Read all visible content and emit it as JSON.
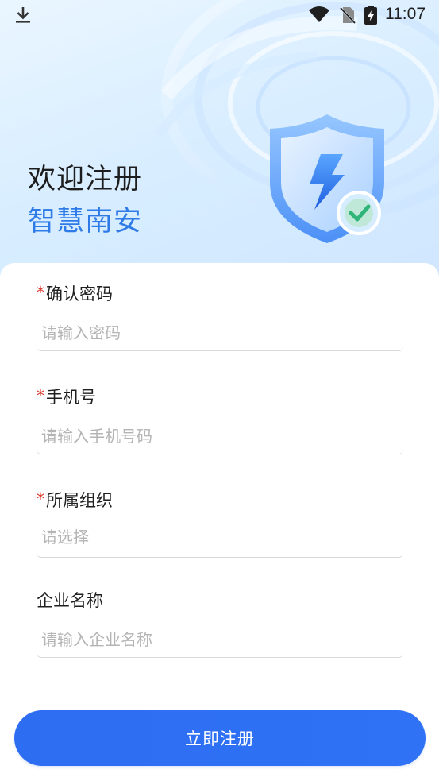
{
  "status_bar": {
    "time": "11:07",
    "icons": [
      "download-icon",
      "wifi-icon",
      "no-sim-icon",
      "battery-charging-icon"
    ]
  },
  "header": {
    "title": "欢迎注册",
    "subtitle": "智慧南安",
    "illustration": "shield-lightning-check-icon"
  },
  "form": {
    "confirm_password": {
      "required_mark": "*",
      "label": "确认密码",
      "placeholder": "请输入密码",
      "value": ""
    },
    "phone": {
      "required_mark": "*",
      "label": "手机号",
      "placeholder": "请输入手机号码",
      "value": ""
    },
    "organization": {
      "required_mark": "*",
      "label": "所属组织",
      "placeholder": "请选择"
    },
    "company_name": {
      "label": "企业名称",
      "placeholder": "请输入企业名称",
      "value": ""
    }
  },
  "submit_label": "立即注册",
  "colors": {
    "accent": "#2e6ff3",
    "subtitle": "#2e7be8",
    "required": "#d9362b",
    "placeholder": "#b4b4b4",
    "hero_bg": "#dcefff"
  }
}
